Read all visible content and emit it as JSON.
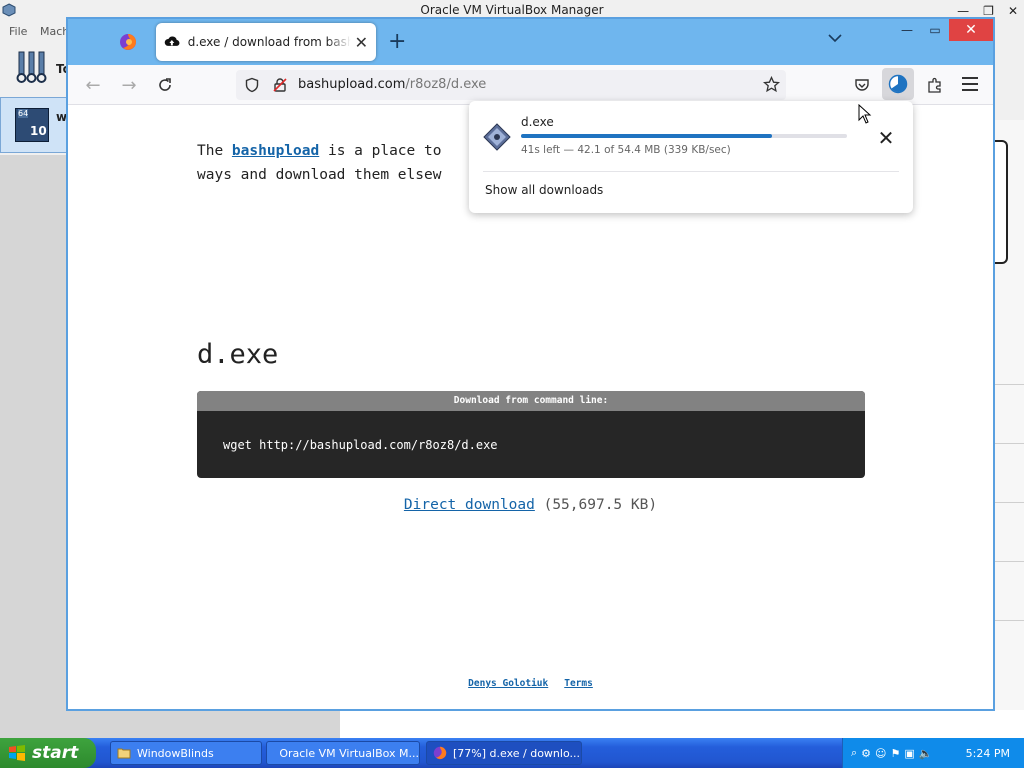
{
  "vbox": {
    "title": "Oracle VM VirtualBox Manager",
    "menu": [
      "File",
      "Mach"
    ],
    "tools_label": "To",
    "vm_label": "wi",
    "vm_os_badge": "10",
    "vm_arch_badge": "64"
  },
  "firefox": {
    "tab_title": "d.exe / download from bashupload",
    "url_host": "bashupload.com",
    "url_path": "/r8oz8/d.exe"
  },
  "page": {
    "intro_prefix": "The ",
    "intro_link": "bashupload",
    "intro_suffix": " is a place to",
    "intro_line2": "ways and download them elsew",
    "file_title": "d.exe",
    "cmd_header": "Download from command line:",
    "cmd_text": "wget http://bashupload.com/r8oz8/d.exe",
    "direct_link": "Direct download",
    "direct_size": " (55,697.5 KB)",
    "footer_author": "Denys Golotiuk",
    "footer_terms": "Terms"
  },
  "downloads": {
    "filename": "d.exe",
    "status": "41s left — 42.1 of 54.4 MB (339 KB/sec)",
    "progress_fraction": 0.77,
    "show_all": "Show all downloads",
    "accent": "#1f73c1"
  },
  "taskbar": {
    "start": "start",
    "tasks": [
      {
        "label": "WindowBlinds"
      },
      {
        "label": "Oracle VM VirtualBox M..."
      },
      {
        "label": "[77%] d.exe / downlo..."
      }
    ],
    "clock": "5:24 PM"
  }
}
